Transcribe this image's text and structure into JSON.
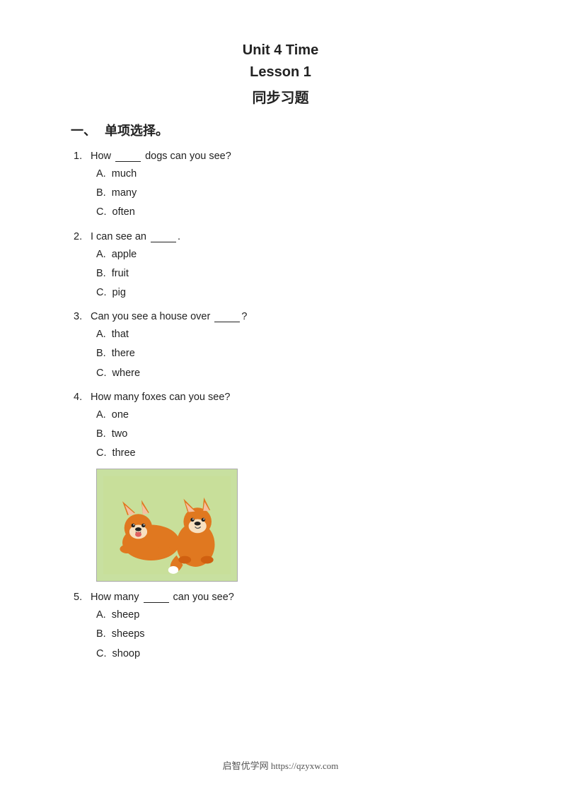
{
  "header": {
    "unit_title": "Unit 4 Time",
    "lesson_title": "Lesson 1",
    "subtitle": "同步习题"
  },
  "section1": {
    "label": "一、",
    "title": "单项选择。"
  },
  "questions": [
    {
      "num": "1.",
      "text_before": "How",
      "blank": true,
      "text_after": "dogs can you see?",
      "options": [
        {
          "letter": "A.",
          "text": "much"
        },
        {
          "letter": "B.",
          "text": "many"
        },
        {
          "letter": "C.",
          "text": "often"
        }
      ]
    },
    {
      "num": "2.",
      "text_before": "I can see an",
      "blank": true,
      "text_after": ".",
      "options": [
        {
          "letter": "A.",
          "text": "apple"
        },
        {
          "letter": "B.",
          "text": "fruit"
        },
        {
          "letter": "C.",
          "text": "pig"
        }
      ]
    },
    {
      "num": "3.",
      "text_before": "Can you see a house over",
      "blank": true,
      "text_after": "?",
      "options": [
        {
          "letter": "A.",
          "text": "that"
        },
        {
          "letter": "B.",
          "text": "there"
        },
        {
          "letter": "C.",
          "text": "where"
        }
      ]
    },
    {
      "num": "4.",
      "text_before": "How many foxes can you see?",
      "blank": false,
      "text_after": "",
      "options": [
        {
          "letter": "A.",
          "text": "one"
        },
        {
          "letter": "B.",
          "text": "two"
        },
        {
          "letter": "C.",
          "text": "three"
        }
      ],
      "has_image": true
    },
    {
      "num": "5.",
      "text_before": "How many",
      "blank": true,
      "text_after": "can you see?",
      "options": [
        {
          "letter": "A.",
          "text": "sheep"
        },
        {
          "letter": "B.",
          "text": "sheeps"
        },
        {
          "letter": "C.",
          "text": "shoop"
        }
      ]
    }
  ],
  "footer": {
    "text": "启智优学网 https://qzyxw.com"
  }
}
